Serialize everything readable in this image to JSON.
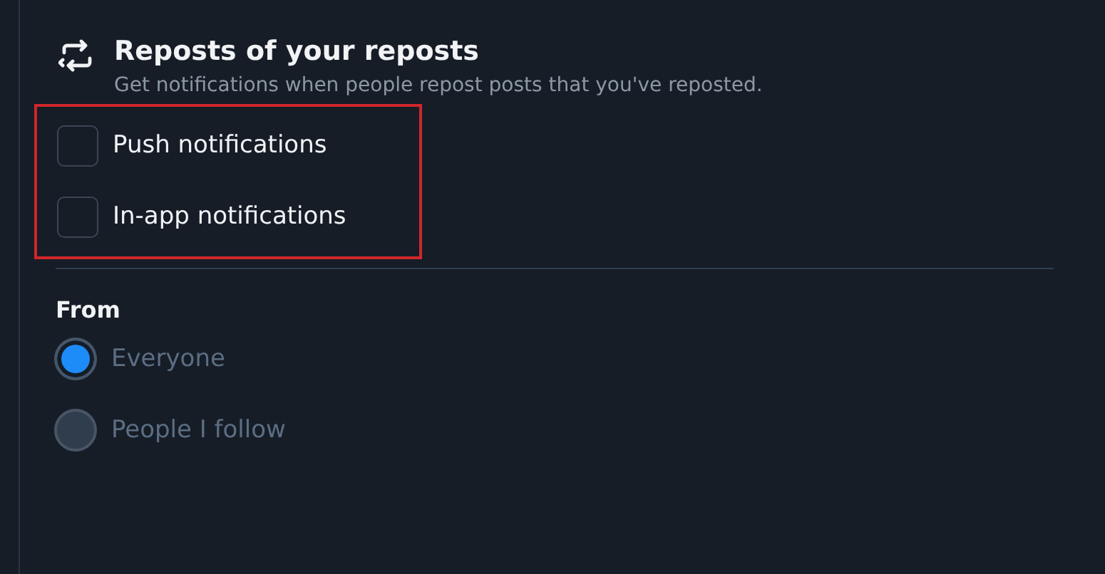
{
  "section": {
    "title": "Reposts of your reposts",
    "description": "Get notifications when people repost posts that you've reposted."
  },
  "channels": {
    "highlighted": true,
    "items": [
      {
        "label": "Push notifications",
        "checked": false
      },
      {
        "label": "In-app notifications",
        "checked": false
      }
    ]
  },
  "from": {
    "heading": "From",
    "options": [
      {
        "label": "Everyone",
        "selected": true,
        "disabled": true
      },
      {
        "label": "People I follow",
        "selected": false,
        "disabled": true
      }
    ]
  }
}
